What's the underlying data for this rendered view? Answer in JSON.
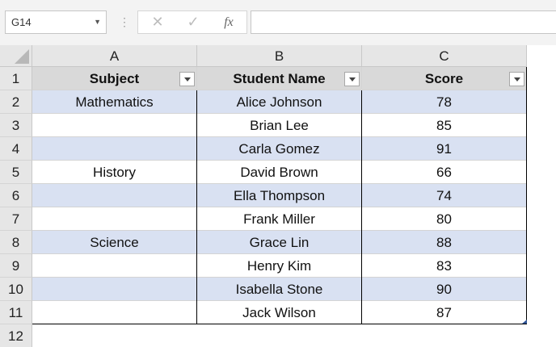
{
  "formula_bar": {
    "name_box": "G14",
    "cancel_icon": "✕",
    "enter_icon": "✓",
    "fx_label": "fx",
    "formula": ""
  },
  "columns": [
    "A",
    "B",
    "C"
  ],
  "rows": [
    "1",
    "2",
    "3",
    "4",
    "5",
    "6",
    "7",
    "8",
    "9",
    "10",
    "11",
    "12"
  ],
  "table": {
    "headers": [
      "Subject",
      "Student Name",
      "Score"
    ],
    "data": [
      {
        "subject": "Mathematics",
        "name": "Alice Johnson",
        "score": "78"
      },
      {
        "subject": "",
        "name": "Brian Lee",
        "score": "85"
      },
      {
        "subject": "",
        "name": "Carla Gomez",
        "score": "91"
      },
      {
        "subject": "History",
        "name": "David Brown",
        "score": "66"
      },
      {
        "subject": "",
        "name": "Ella Thompson",
        "score": "74"
      },
      {
        "subject": "",
        "name": "Frank Miller",
        "score": "80"
      },
      {
        "subject": "Science",
        "name": "Grace Lin",
        "score": "88"
      },
      {
        "subject": "",
        "name": "Henry Kim",
        "score": "83"
      },
      {
        "subject": "",
        "name": "Isabella Stone",
        "score": "90"
      },
      {
        "subject": "",
        "name": "Jack Wilson",
        "score": "87"
      }
    ]
  },
  "colors": {
    "band": "#d9e1f2",
    "header_fill": "#d9d9d9",
    "header_bar": "#e6e6e6"
  }
}
